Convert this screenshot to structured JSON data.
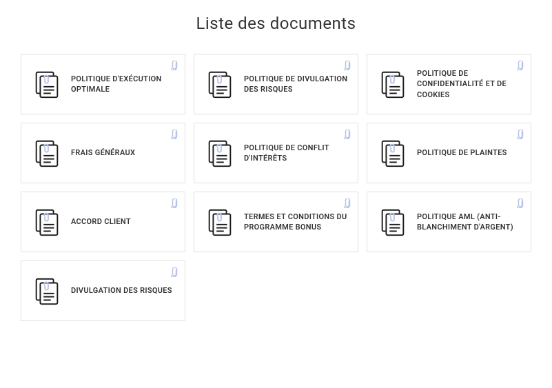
{
  "title": "Liste des documents",
  "documents": [
    {
      "label": "POLITIQUE D'EXÉCUTION OPTIMALE"
    },
    {
      "label": "POLITIQUE DE DIVULGATION DES RISQUES"
    },
    {
      "label": "POLITIQUE DE CONFIDENTIALITÉ ET DE COOKIES"
    },
    {
      "label": "FRAIS GÉNÉRAUX"
    },
    {
      "label": "POLITIQUE DE CONFLIT D'INTÉRÊTS"
    },
    {
      "label": "POLITIQUE DE PLAINTES"
    },
    {
      "label": "ACCORD CLIENT"
    },
    {
      "label": "TERMES ET CONDITIONS DU PROGRAMME BONUS"
    },
    {
      "label": "POLITIQUE AML (ANTI-BLANCHIMENT D'ARGENT)"
    },
    {
      "label": "DIVULGATION DES RISQUES"
    }
  ]
}
